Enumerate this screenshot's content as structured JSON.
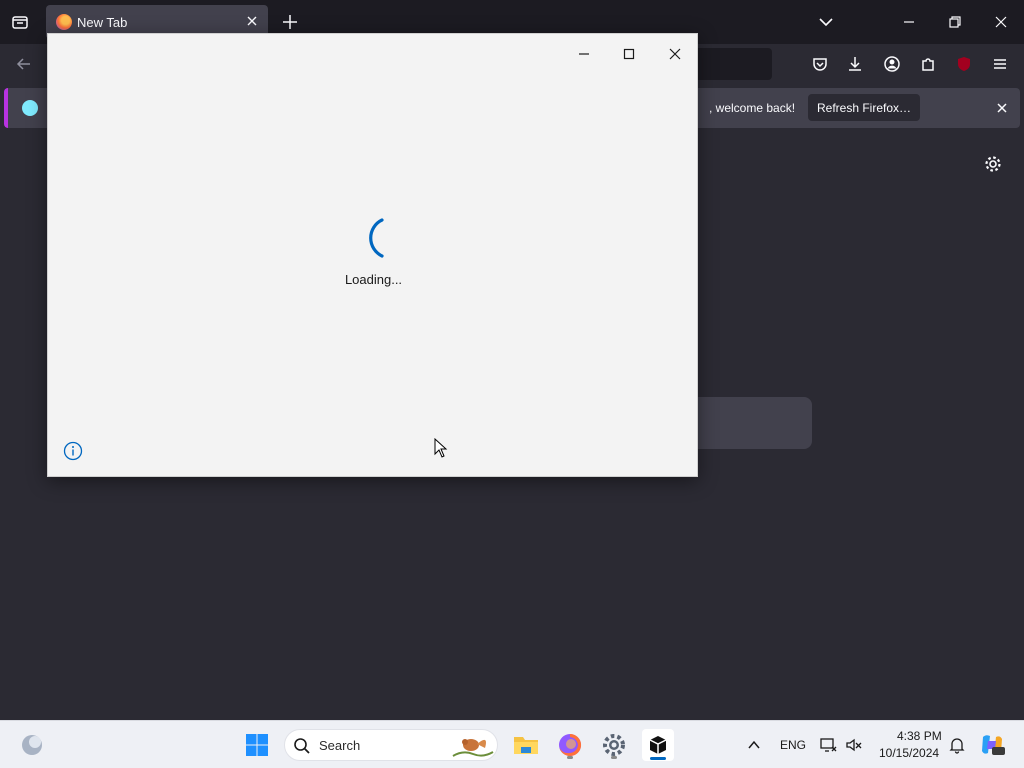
{
  "browser": {
    "tab_title": "New Tab",
    "notification": {
      "text": ", welcome back!",
      "button": "Refresh Firefox…"
    }
  },
  "dialog": {
    "loading_text": "Loading...",
    "spinner_color": "#0067c0"
  },
  "taskbar": {
    "search_label": "Search",
    "language": "ENG",
    "time": "4:38 PM",
    "date": "10/15/2024"
  },
  "colors": {
    "browser_bg": "#2b2a33",
    "tabstrip_bg": "#1c1b22",
    "notification_accent": "#b833e1",
    "taskbar_bg": "#eef0f5"
  }
}
